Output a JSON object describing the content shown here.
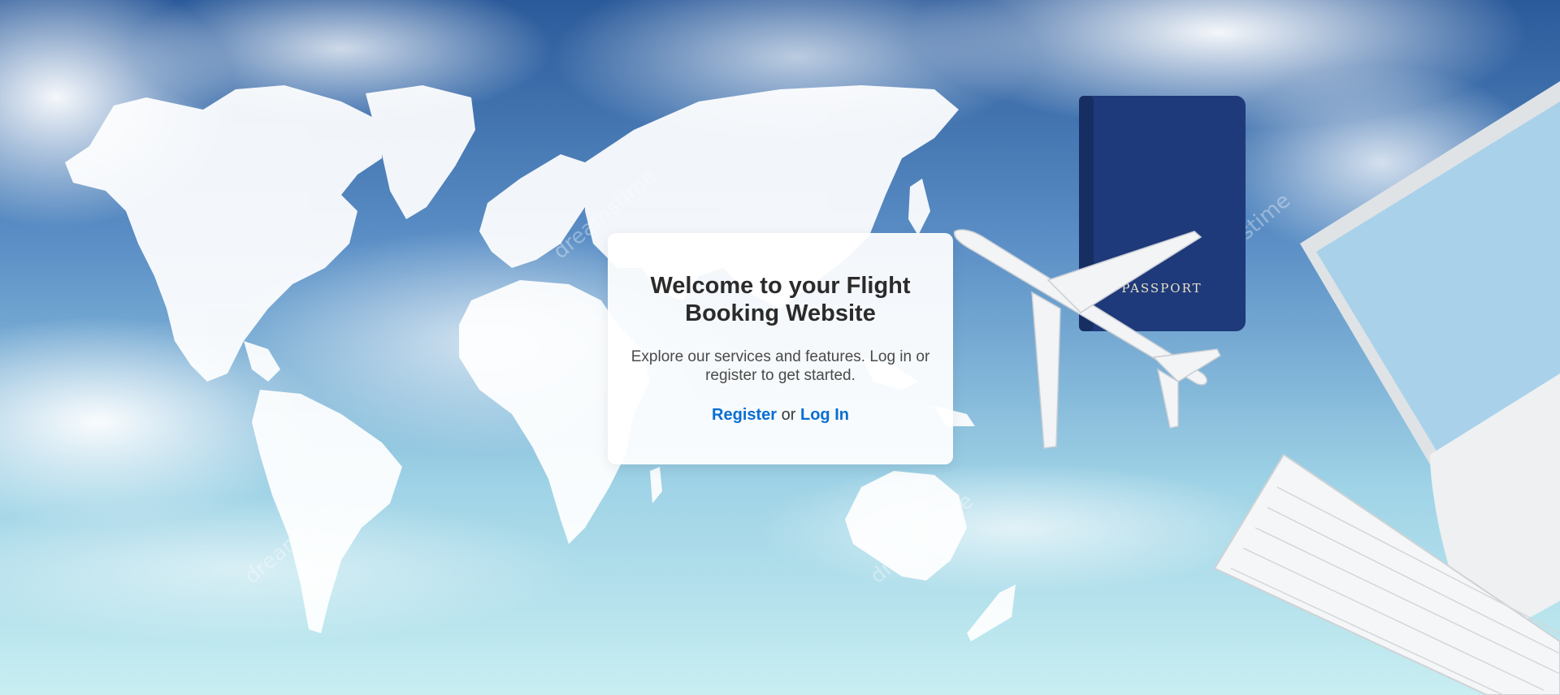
{
  "hero": {
    "passport_label": "PASSPORT",
    "watermark": "dreamstime",
    "icons": [
      "world-map",
      "airplane",
      "passport",
      "laptop",
      "keyboard"
    ]
  },
  "welcome": {
    "title": "Welcome to your Flight Booking Website",
    "description": "Explore our services and features. Log in or register to get started.",
    "register_label": "Register",
    "separator": "or",
    "login_label": "Log In"
  },
  "colors": {
    "link": "#0a6ed1",
    "sky_top": "#2c5c9c",
    "sky_bottom": "#c8eef2",
    "passport": "#1f3a7a"
  }
}
